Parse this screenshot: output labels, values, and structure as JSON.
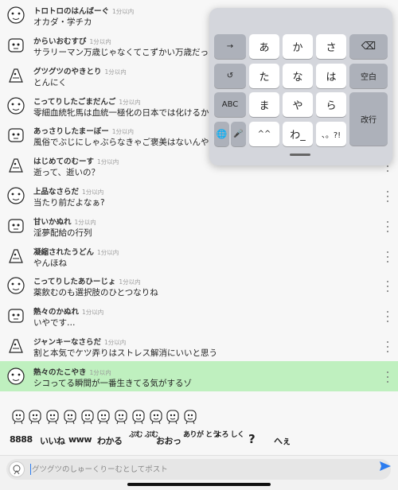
{
  "comments": [
    {
      "name": "トロトロのはんばーぐ",
      "time": "1分以内",
      "text": "オカダ・学チカ",
      "highlight": false
    },
    {
      "name": "からいおむすび",
      "time": "1分以内",
      "text": "サラリーマン万歳じゃなくてこずかい万歳だった",
      "highlight": false
    },
    {
      "name": "グツグツのやきとり",
      "time": "1分以内",
      "text": "とんにく",
      "highlight": false
    },
    {
      "name": "こってりしたごまだんご",
      "time": "1分以内",
      "text": "零細血統牝馬は血統一極化の日本では化けるから見て",
      "highlight": false
    },
    {
      "name": "あっさりしたまーぼー",
      "time": "1分以内",
      "text": "風俗でぶじにしゃぶらなきゃご褒美はないんやど",
      "highlight": false
    },
    {
      "name": "はじめてのむーす",
      "time": "1分以内",
      "text": "逝って、逝いの？",
      "highlight": false
    },
    {
      "name": "上品なさらだ",
      "time": "1分以内",
      "text": "当たり前だよなぁ?",
      "highlight": false
    },
    {
      "name": "甘いかぬれ",
      "time": "1分以内",
      "text": "淫夢配給の行列",
      "highlight": false
    },
    {
      "name": "凝縮されたうどん",
      "time": "1分以内",
      "text": "やんほね",
      "highlight": false
    },
    {
      "name": "こってりしたあひーじょ",
      "time": "1分以内",
      "text": "薬飲むのも選択肢のひとつなりね",
      "highlight": false
    },
    {
      "name": "熱々のかぬれ",
      "time": "1分以内",
      "text": "いやです…",
      "highlight": false
    },
    {
      "name": "ジャンキーなさらだ",
      "time": "1分以内",
      "text": "割と本気でケツ弄りはストレス解消にいいと思う",
      "highlight": false
    },
    {
      "name": "熱々のたこやき",
      "time": "1分以内",
      "text": "シコってる瞬間が一番生きてる気がするゾ",
      "highlight": true
    }
  ],
  "keyboard": {
    "arrow": "→",
    "undo": "↺",
    "abc": "ABC",
    "globe": "🌐",
    "mic": "🎤",
    "kana": [
      "あ",
      "か",
      "さ",
      "た",
      "な",
      "は",
      "ま",
      "や",
      "ら",
      "^^",
      "わ_",
      "、。?!"
    ],
    "delete": "⌫",
    "space": "空白",
    "enter": "改行"
  },
  "stamps": [
    "stamp-1",
    "stamp-2",
    "stamp-3",
    "stamp-4",
    "stamp-5",
    "stamp-6",
    "stamp-7",
    "stamp-8",
    "stamp-9",
    "stamp-10",
    "stamp-11"
  ],
  "quick_words": [
    {
      "text": "8888",
      "stack": false,
      "big": false
    },
    {
      "text": "いいね",
      "stack": false,
      "big": false
    },
    {
      "text": "www",
      "stack": false,
      "big": false
    },
    {
      "text": "わかる",
      "stack": false,
      "big": false
    },
    {
      "text": "ぷむ ぷむ",
      "stack": true,
      "big": false
    },
    {
      "text": "おおっ",
      "stack": false,
      "big": false
    },
    {
      "text": "ありが とう",
      "stack": true,
      "big": false
    },
    {
      "text": "よろ しく",
      "stack": true,
      "big": false
    },
    {
      "text": "?",
      "stack": false,
      "big": true
    },
    {
      "text": "へぇ",
      "stack": false,
      "big": false
    }
  ],
  "input": {
    "placeholder": "グツグツのしゅーくりーむとしてポスト"
  },
  "colors": {
    "highlight": "#bff0bf",
    "send": "#2b7cf0"
  }
}
